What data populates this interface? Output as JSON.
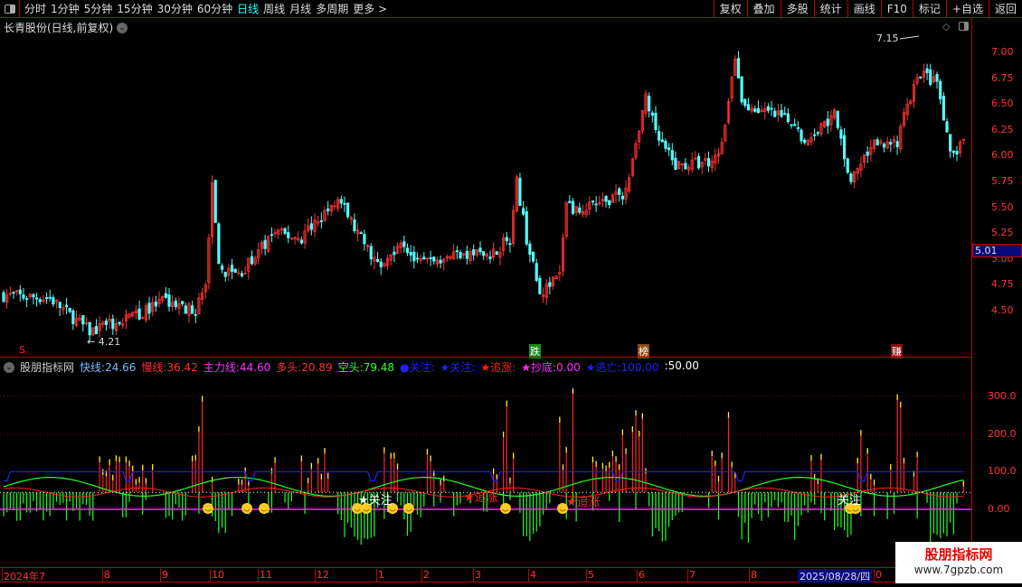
{
  "toolbar": {
    "periods": [
      "分时",
      "1分钟",
      "5分钟",
      "15分钟",
      "30分钟",
      "60分钟",
      "日线",
      "周线",
      "月线",
      "多周期",
      "更多 >"
    ],
    "active": "日线",
    "right_buttons": [
      "复权",
      "叠加",
      "多股",
      "统计",
      "画线",
      "F10",
      "标记",
      "+自选",
      "返回"
    ]
  },
  "chart_title": "长青股份(日线,前复权)",
  "price_axis": {
    "ticks": [
      "7.00",
      "6.75",
      "6.50",
      "6.25",
      "6.00",
      "5.75",
      "5.50",
      "5.25",
      "5.00",
      "4.75",
      "4.50"
    ],
    "current_price": "5.01"
  },
  "annotations": {
    "high": "7.15",
    "low": "4.21"
  },
  "signal_tags": [
    {
      "text": "S",
      "color": "#ff2020"
    },
    {
      "text": "跌",
      "color": "#1a8a1a"
    },
    {
      "text": "榜",
      "color": "#8a4a10"
    },
    {
      "text": "赚",
      "color": "#8a1010"
    }
  ],
  "indicator": {
    "name": "股朋指标网",
    "values": [
      {
        "label": "快线:",
        "value": "24.66",
        "color": "#7ab8ff"
      },
      {
        "label": "慢线:",
        "value": "36.42",
        "color": "#ff3030"
      },
      {
        "label": "主力线:",
        "value": "44.60",
        "color": "#ff30ff"
      },
      {
        "label": "多头:",
        "value": "20.89",
        "color": "#ff3030"
      },
      {
        "label": "空头:",
        "value": "79.48",
        "color": "#30ff30"
      },
      {
        "label": "●关注:",
        "value": "",
        "color": "#2020ff"
      },
      {
        "label": "★关注:",
        "value": "",
        "color": "#2020ff"
      },
      {
        "label": "★追涨:",
        "value": "",
        "color": "#ff2020"
      },
      {
        "label": "★抄底:",
        "value": "0.00",
        "color": "#ff30ff"
      },
      {
        "label": "★逃亡:",
        "value": "100.00",
        "color": "#2020ff"
      },
      {
        "label": ":",
        "value": "50.00",
        "color": "#ffffff"
      }
    ],
    "axis_ticks": [
      "300.0",
      "200.0",
      "100.0",
      "0.00"
    ],
    "chart_labels": [
      {
        "text": "★关注",
        "color": "#ffffff"
      },
      {
        "text": "★追涨",
        "color": "#ff2020"
      },
      {
        "text": "★追涨",
        "color": "#ff2020"
      },
      {
        "text": "关注",
        "color": "#ffffff"
      }
    ]
  },
  "date_axis": {
    "labels": [
      "2024年7",
      "8",
      "9",
      "10",
      "11",
      "12",
      "1",
      "2",
      "3",
      "4",
      "5",
      "6",
      "7",
      "8"
    ],
    "cursor_date": "2025/08/28/四",
    "end_label": "0"
  },
  "watermark": {
    "title": "股朋指标网",
    "url": "www.7gpzb.com"
  },
  "chart_data": {
    "type": "candlestick",
    "ylim": [
      4.2,
      7.2
    ],
    "indicator_ylim": [
      -100,
      380
    ],
    "close_path": [
      [
        0,
        4.65
      ],
      [
        14,
        4.62
      ],
      [
        26,
        4.3
      ],
      [
        41,
        4.45
      ],
      [
        49,
        4.6
      ],
      [
        58,
        4.5
      ],
      [
        61,
        4.8
      ],
      [
        63,
        5.7
      ],
      [
        65,
        4.9
      ],
      [
        71,
        4.85
      ],
      [
        82,
        5.25
      ],
      [
        90,
        5.2
      ],
      [
        101,
        5.6
      ],
      [
        106,
        5.3
      ],
      [
        114,
        4.9
      ],
      [
        120,
        5.2
      ],
      [
        125,
        4.95
      ],
      [
        136,
        5.05
      ],
      [
        147,
        5.05
      ],
      [
        153,
        5.2
      ],
      [
        155,
        5.75
      ],
      [
        158,
        5.2
      ],
      [
        162,
        4.65
      ],
      [
        168,
        4.85
      ],
      [
        170,
        5.5
      ],
      [
        177,
        5.5
      ],
      [
        188,
        5.65
      ],
      [
        194,
        6.6
      ],
      [
        197,
        6.2
      ],
      [
        203,
        5.9
      ],
      [
        215,
        5.95
      ],
      [
        218,
        6.3
      ],
      [
        221,
        6.9
      ],
      [
        223,
        6.5
      ],
      [
        232,
        6.4
      ],
      [
        240,
        6.3
      ],
      [
        242,
        6.1
      ],
      [
        251,
        6.4
      ],
      [
        256,
        5.75
      ],
      [
        262,
        6.1
      ],
      [
        270,
        6.1
      ],
      [
        272,
        6.4
      ],
      [
        277,
        6.8
      ],
      [
        282,
        6.7
      ],
      [
        286,
        6.0
      ],
      [
        290,
        6.1
      ]
    ],
    "colors": {
      "up": "#ff3232",
      "down": "#54ffff",
      "background": "#000000"
    }
  }
}
